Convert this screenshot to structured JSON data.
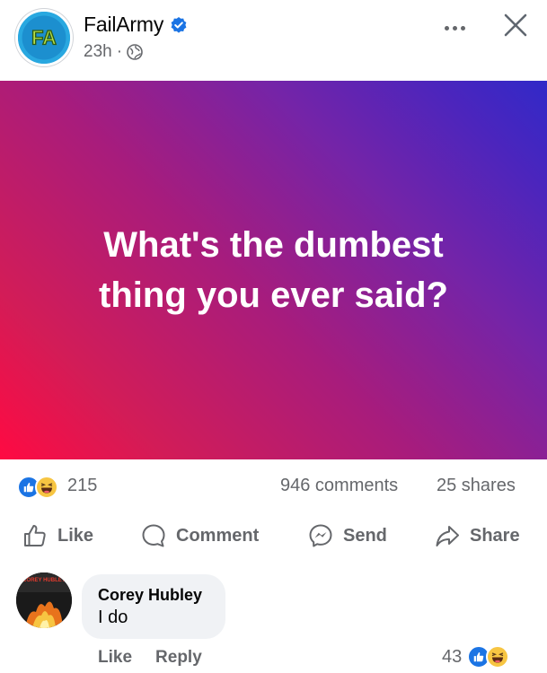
{
  "header": {
    "page_name": "FailArmy",
    "avatar_text": "FA",
    "timestamp": "23h",
    "separator": "·"
  },
  "post": {
    "text": "What's the dumbest thing you ever said?",
    "gradient_colors": [
      "#ff0a42",
      "#a81c7c",
      "#3129c8"
    ]
  },
  "stats": {
    "reaction_count": "215",
    "comments": "946 comments",
    "shares": "25 shares"
  },
  "actions": {
    "like": "Like",
    "comment": "Comment",
    "send": "Send",
    "share": "Share"
  },
  "comment": {
    "author": "Corey Hubley",
    "text": "I do",
    "like_label": "Like",
    "reply_label": "Reply",
    "reaction_count": "43",
    "avatar_text": "COREY HUBLEY"
  },
  "icons": [
    "verified-icon",
    "globe-icon",
    "more-icon",
    "close-icon",
    "thumbs-up-icon",
    "comment-icon",
    "messenger-icon",
    "share-arrow-icon",
    "like-reaction-icon",
    "haha-reaction-icon"
  ],
  "colors": {
    "facebook_blue": "#1b74e4",
    "secondary_text": "#65676b",
    "comment_bubble": "#f0f2f5"
  }
}
